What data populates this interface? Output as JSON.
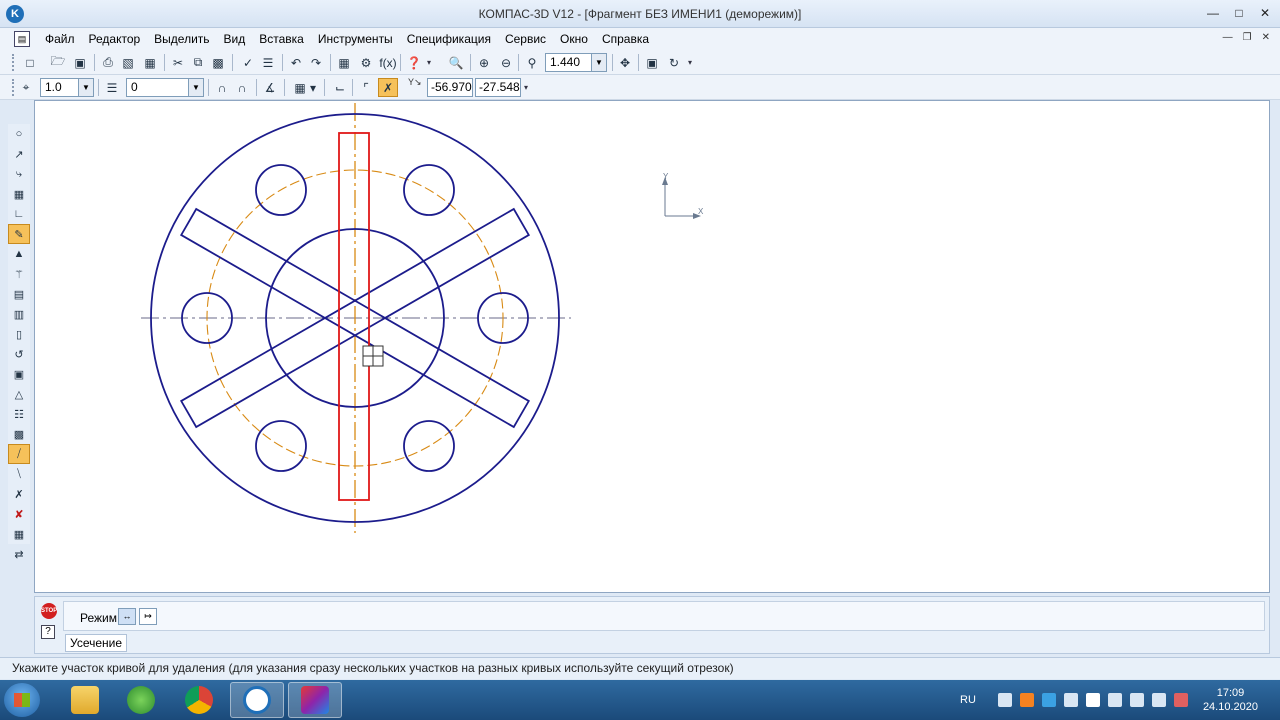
{
  "window": {
    "logo": "K",
    "title": "КОМПАС-3D V12 - [Фрагмент БЕЗ ИМЕНИ1 (деморежим)]"
  },
  "menu": {
    "items": [
      {
        "id": "file",
        "label": "Файл"
      },
      {
        "id": "edit",
        "label": "Редактор"
      },
      {
        "id": "select",
        "label": "Выделить"
      },
      {
        "id": "view",
        "label": "Вид"
      },
      {
        "id": "insert",
        "label": "Вставка"
      },
      {
        "id": "tools",
        "label": "Инструменты"
      },
      {
        "id": "spec",
        "label": "Спецификация"
      },
      {
        "id": "service",
        "label": "Сервис"
      },
      {
        "id": "window",
        "label": "Окно"
      },
      {
        "id": "help",
        "label": "Справка"
      }
    ]
  },
  "toolbar1": {
    "zoom_value": "1.440"
  },
  "toolbar2": {
    "step_value": "1.0",
    "layer_value": "0",
    "coord_x": "-56.970",
    "coord_y": "-27.548"
  },
  "canvas": {
    "axis_y_label": "Y",
    "axis_x_label": "X",
    "colors": {
      "outline": "#1c1c8c",
      "centerline": "#d88a14",
      "highlight": "#e01818"
    }
  },
  "property_panel": {
    "stop_label": "STOP",
    "help_label": "?",
    "mode_label": "Режим",
    "command_tab": "Усечение"
  },
  "status": {
    "text": "Укажите участок кривой для удаления (для указания сразу нескольких участков на разных кривых используйте секущий отрезок)"
  },
  "taskbar": {
    "language": "RU",
    "time": "17:09",
    "date": "24.10.2020"
  }
}
